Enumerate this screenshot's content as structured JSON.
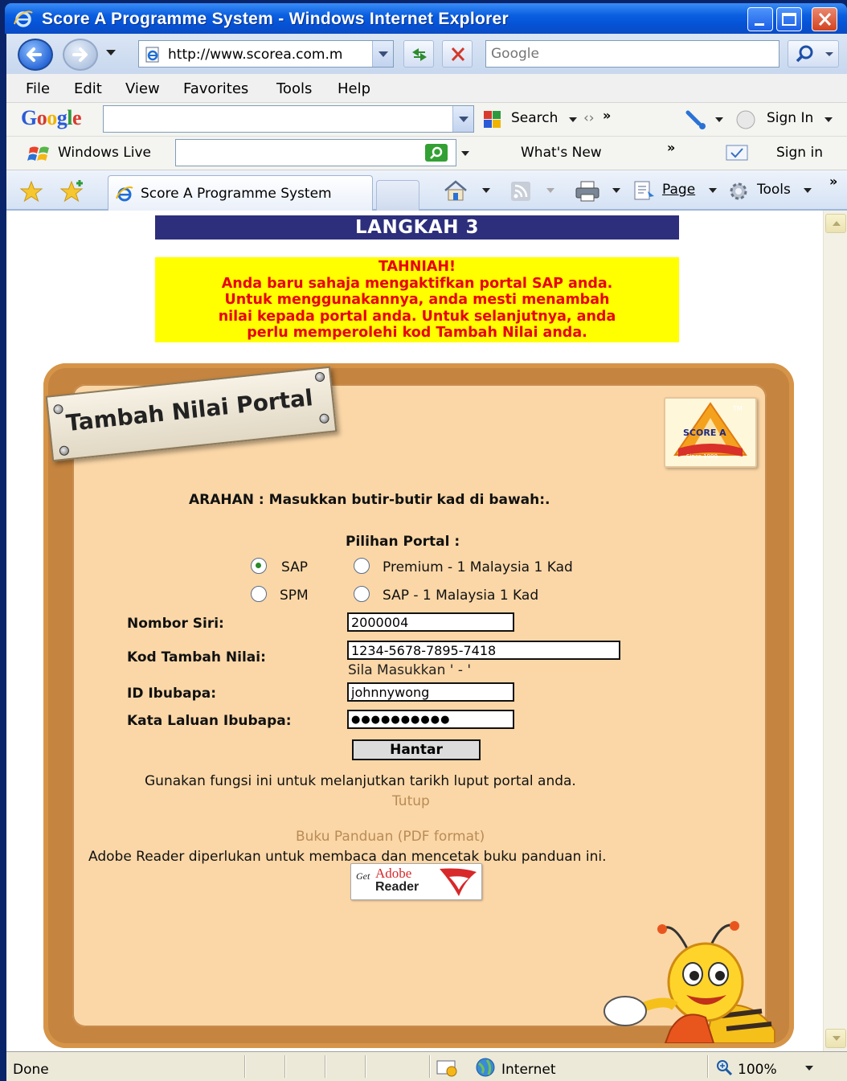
{
  "window": {
    "title": "Score A Programme System - Windows Internet Explorer"
  },
  "address_bar": {
    "url": "http://www.scorea.com.m",
    "search_placeholder": "Google"
  },
  "menu": {
    "items": [
      "File",
      "Edit",
      "View",
      "Favorites",
      "Tools",
      "Help"
    ]
  },
  "google_toolbar": {
    "logo": "Google",
    "search_label": "Search",
    "chevron": "»",
    "sign_in_label": "Sign In"
  },
  "live_toolbar": {
    "brand": "Windows Live",
    "whats_new": "What's New",
    "chevron": "»",
    "sign_in": "Sign in"
  },
  "tab_bar": {
    "active_tab": "Score A Programme System",
    "page_label": "Page",
    "tools_label": "Tools",
    "chevron": "»"
  },
  "page": {
    "step_title": "LANGKAH 3",
    "congrats": {
      "line1": "TAHNIAH!",
      "line2": "Anda baru sahaja mengaktifkan portal SAP anda.",
      "line3": "Untuk menggunakannya, anda mesti menambah",
      "line4": "nilai kepada portal anda. Untuk selanjutnya, anda",
      "line5": "perlu memperolehi kod Tambah Nilai anda."
    },
    "plaque_title": "Tambah Nilai Portal",
    "logo": {
      "brand": "SCORE A",
      "tm": "TM",
      "since": "Since 1999"
    },
    "instruction": "ARAHAN : Masukkan butir-butir kad di bawah:.",
    "portal_choice_label": "Pilihan Portal :",
    "portal_options": [
      {
        "label": "SAP",
        "checked": true
      },
      {
        "label": "Premium - 1 Malaysia 1 Kad",
        "checked": false
      },
      {
        "label": "SPM",
        "checked": false
      },
      {
        "label": "SAP - 1 Malaysia 1 Kad",
        "checked": false
      }
    ],
    "fields": {
      "serial_label": "Nombor Siri:",
      "serial_value": "2000004",
      "code_label": "Kod Tambah Nilai:",
      "code_value": "1234-5678-7895-7418",
      "code_hint": "Sila Masukkan ' - '",
      "parent_id_label": "ID Ibubapa:",
      "parent_id_value": "johnnywong",
      "password_label": "Kata Laluan Ibubapa:",
      "password_value": "●●●●●●●●●●"
    },
    "submit_label": "Hantar",
    "extend_note": "Gunakan fungsi ini untuk melanjutkan tarikh luput portal anda.",
    "close_link": "Tutup",
    "manual_link": "Buku Panduan (PDF format)",
    "manual_note": "Adobe Reader diperlukan untuk membaca dan mencetak buku panduan ini.",
    "adobe_badge": {
      "get": "Get",
      "adobe": "Adobe",
      "reader": "Reader"
    }
  },
  "status_bar": {
    "status": "Done",
    "zone": "Internet",
    "zoom": "100%"
  },
  "colors": {
    "title_bar": "#0552d5",
    "banner": "#2d2f7c",
    "alert_bg": "#ffff00",
    "alert_text": "#e8000b",
    "board_frame": "#c5843f",
    "board_fill": "#fbd7a7"
  }
}
